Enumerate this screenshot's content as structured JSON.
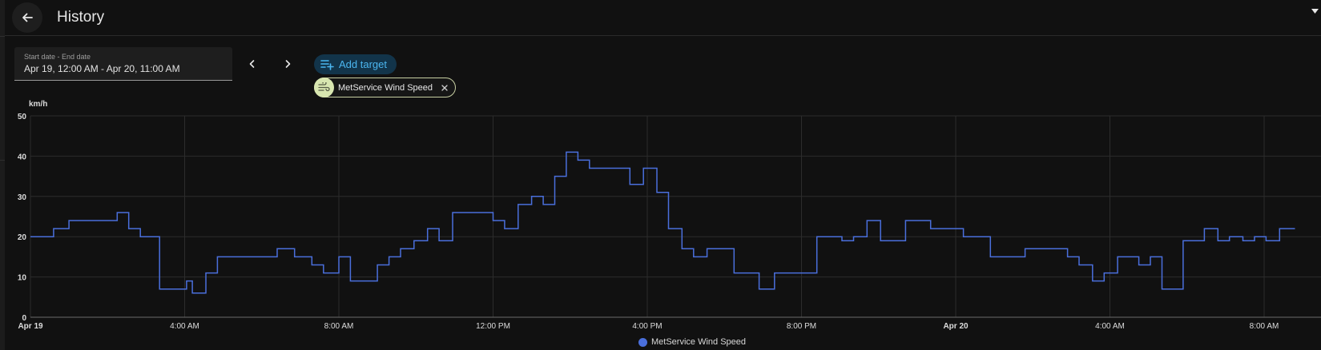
{
  "header": {
    "title": "History"
  },
  "date_range": {
    "label": "Start date - End date",
    "value": "Apr 19, 12:00 AM - Apr 20, 11:00 AM"
  },
  "add_target": {
    "label": "Add target"
  },
  "target_chip": {
    "label": "MetService Wind Speed",
    "icon": "weather-windy-icon"
  },
  "colors": {
    "background": "#111111",
    "series": "#4a6fdc",
    "accent": "#4bb6f0",
    "chip_icon_bg": "#d8e6b0"
  },
  "chart_data": {
    "type": "line",
    "step": true,
    "ylabel": "km/h",
    "ylim": [
      0,
      50
    ],
    "y_ticks": [
      "0",
      "10",
      "20",
      "30",
      "40",
      "50"
    ],
    "x_ticks": [
      "Apr 19",
      "4:00 AM",
      "8:00 AM",
      "12:00 PM",
      "4:00 PM",
      "8:00 PM",
      "Apr 20",
      "4:00 AM",
      "8:00 AM"
    ],
    "x_tick_hours": [
      0,
      4,
      8,
      12,
      16,
      20,
      24,
      28,
      32
    ],
    "xlim_hours": [
      0,
      32.8
    ],
    "grid": true,
    "legend": "bottom-center",
    "series": [
      {
        "name": "MetService Wind Speed",
        "x_hours": [
          0,
          0.6,
          1,
          2.25,
          2.55,
          2.85,
          3.35,
          4.05,
          4.2,
          4.55,
          4.85,
          6.4,
          6.85,
          7.3,
          7.6,
          8,
          8.3,
          9,
          9.3,
          9.6,
          9.95,
          10.3,
          10.6,
          10.95,
          11.3,
          12,
          12.3,
          12.65,
          13,
          13.3,
          13.6,
          13.9,
          14.2,
          14.5,
          15.55,
          15.9,
          16.25,
          16.55,
          16.9,
          17.2,
          17.55,
          18.25,
          18.9,
          19.3,
          20.4,
          21.05,
          21.35,
          21.7,
          22.05,
          22.7,
          23.35,
          24.2,
          24.9,
          25.8,
          26.9,
          27.2,
          27.55,
          27.85,
          28.2,
          28.75,
          29.05,
          29.35,
          29.9,
          30.45,
          30.8,
          31.1,
          31.45,
          31.75,
          32.05,
          32.4
        ],
        "values": [
          20,
          22,
          24,
          26,
          22,
          20,
          7,
          9,
          6,
          11,
          15,
          17,
          15,
          13,
          11,
          15,
          9,
          13,
          15,
          17,
          19,
          22,
          19,
          26,
          26,
          24,
          22,
          28,
          30,
          28,
          35,
          41,
          39,
          37,
          33,
          37,
          31,
          22,
          17,
          15,
          17,
          11,
          7,
          11,
          20,
          19,
          20,
          24,
          19,
          24,
          22,
          20,
          15,
          17,
          15,
          13,
          9,
          11,
          15,
          13,
          15,
          7,
          19,
          22,
          19,
          20,
          19,
          20,
          19,
          22
        ]
      }
    ]
  }
}
